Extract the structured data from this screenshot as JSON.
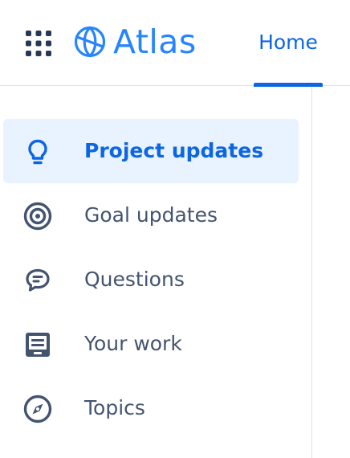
{
  "header": {
    "app_switcher_icon": "grid-icon",
    "logo_icon": "atlas-globe-icon",
    "logo_text": "Atlas",
    "brand_color": "#2684ff",
    "nav": {
      "home_label": "Home",
      "active_color": "#0c66e4"
    }
  },
  "sidebar": {
    "items": [
      {
        "label": "Project updates",
        "icon": "lightbulb-icon",
        "active": true
      },
      {
        "label": "Goal updates",
        "icon": "target-icon",
        "active": false
      },
      {
        "label": "Questions",
        "icon": "speech-bubble-icon",
        "active": false
      },
      {
        "label": "Your work",
        "icon": "list-tray-icon",
        "active": false
      },
      {
        "label": "Topics",
        "icon": "compass-icon",
        "active": false
      }
    ],
    "active_background": "#e9f2ff"
  }
}
